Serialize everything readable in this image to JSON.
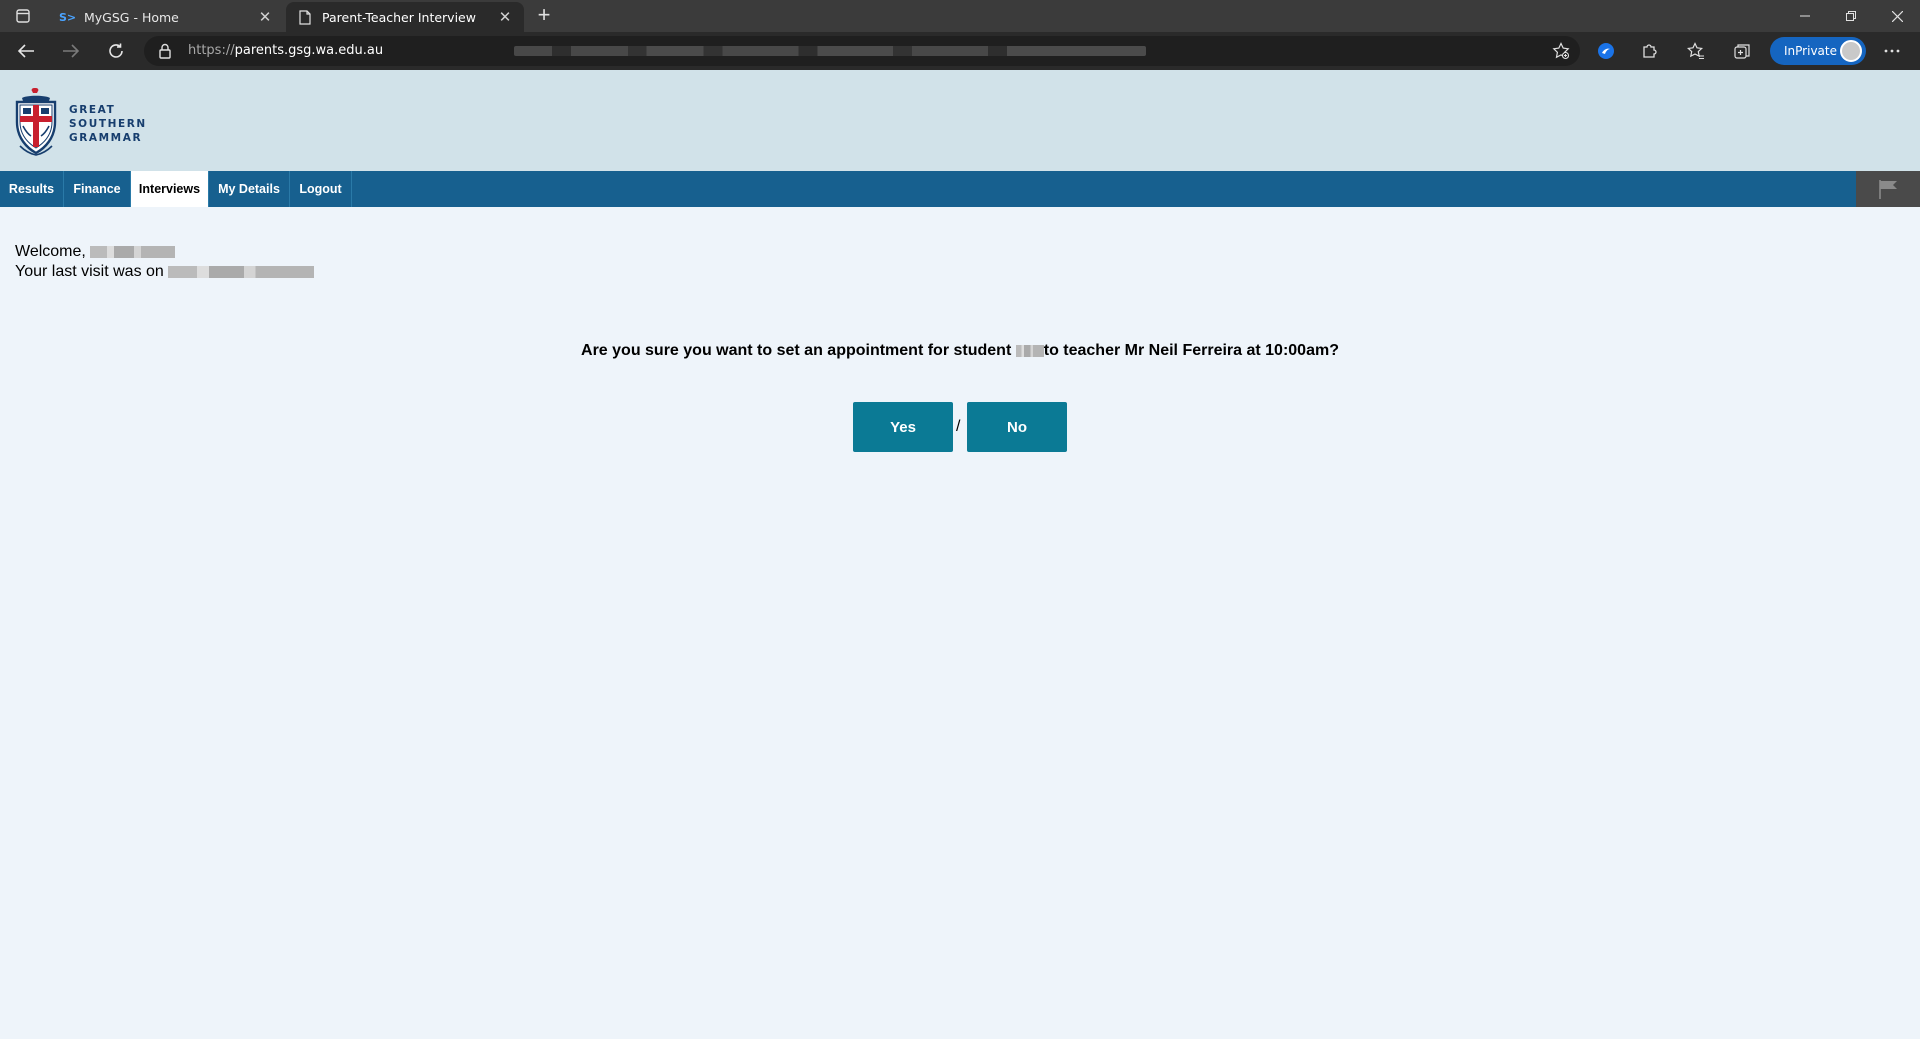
{
  "browser": {
    "tabs": [
      {
        "title": "MyGSG - Home",
        "active": false
      },
      {
        "title": "Parent-Teacher Interview",
        "active": true
      }
    ],
    "address": {
      "scheme": "https://",
      "host": "parents.gsg.wa.edu.au"
    },
    "inprivate_label": "InPrivate",
    "accent_color": "#1565c0"
  },
  "header": {
    "school_name_lines": [
      "GREAT",
      "SOUTHERN",
      "GRAMMAR"
    ],
    "logo_icon": "school-crest-icon",
    "bg_color": "#d1e2e9"
  },
  "nav": {
    "items": [
      "Results",
      "Finance",
      "Interviews",
      "My Details",
      "Logout"
    ],
    "active": "Interviews",
    "bg_color": "#17608f"
  },
  "welcome": {
    "greeting": "Welcome,",
    "last_visit": "Your last visit was on"
  },
  "dialog": {
    "question_prefix": "Are you sure you want to set an appointment for student",
    "question_suffix": "to teacher Mr Neil Ferreira at 10:00am?",
    "yes_label": "Yes",
    "separator": "/",
    "no_label": "No",
    "button_color": "#0b7a95"
  }
}
